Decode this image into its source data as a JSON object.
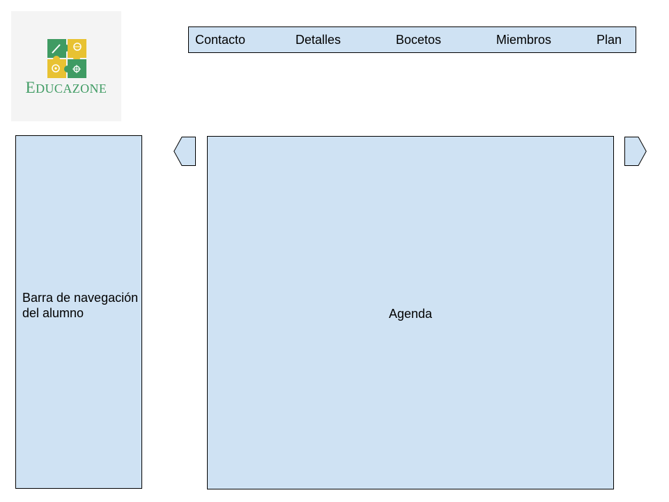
{
  "logo": {
    "text_cap": "E",
    "text_rest": "DUCAZONE",
    "colors": {
      "green": "#3f9b63",
      "yellow": "#e8c232",
      "background": "#f4f4f4"
    }
  },
  "nav": {
    "items": [
      "Contacto",
      "Detalles",
      "Bocetos",
      "Miembros",
      "Plan"
    ]
  },
  "sidebar": {
    "label": "Barra de navegación del alumno"
  },
  "main": {
    "label": "Agenda"
  },
  "arrows": {
    "prev_icon": "arrow-left-icon",
    "next_icon": "arrow-right-icon"
  },
  "colors": {
    "panel_fill": "#cfe2f3",
    "border": "#000000"
  }
}
